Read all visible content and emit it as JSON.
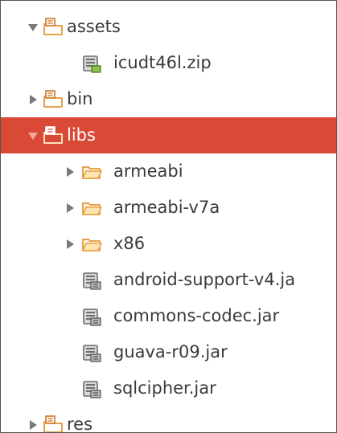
{
  "colors": {
    "selection": "#d94a36",
    "text": "#3a3a3a",
    "selected_text": "#ffffff",
    "folder": "#e8a24a",
    "package": "#c9782c",
    "archive": "#6d6d6d",
    "twisty": "#7a7a7a"
  },
  "tree": [
    {
      "label": "assets",
      "kind": "folder",
      "icon": "package-folder-icon",
      "state": "expanded",
      "depth": 0
    },
    {
      "label": "icudt46l.zip",
      "kind": "archive",
      "icon": "archive-icon",
      "depth": 1
    },
    {
      "label": "bin",
      "kind": "folder",
      "icon": "package-folder-icon",
      "state": "collapsed",
      "depth": 0
    },
    {
      "label": "libs",
      "kind": "folder",
      "icon": "package-folder-icon",
      "state": "expanded",
      "depth": 0,
      "selected": true
    },
    {
      "label": "armeabi",
      "kind": "folder",
      "icon": "folder-icon",
      "state": "collapsed",
      "depth": 1
    },
    {
      "label": "armeabi-v7a",
      "kind": "folder",
      "icon": "folder-icon",
      "state": "collapsed",
      "depth": 1
    },
    {
      "label": "x86",
      "kind": "folder",
      "icon": "folder-icon",
      "state": "collapsed",
      "depth": 1
    },
    {
      "label": "android-support-v4.ja",
      "kind": "jar",
      "icon": "jar-icon",
      "depth": 1
    },
    {
      "label": "commons-codec.jar",
      "kind": "jar",
      "icon": "jar-icon",
      "depth": 1
    },
    {
      "label": "guava-r09.jar",
      "kind": "jar",
      "icon": "jar-icon",
      "depth": 1
    },
    {
      "label": "sqlcipher.jar",
      "kind": "jar",
      "icon": "jar-icon",
      "depth": 1
    },
    {
      "label": "res",
      "kind": "folder",
      "icon": "package-folder-icon",
      "state": "collapsed",
      "depth": 0
    }
  ]
}
